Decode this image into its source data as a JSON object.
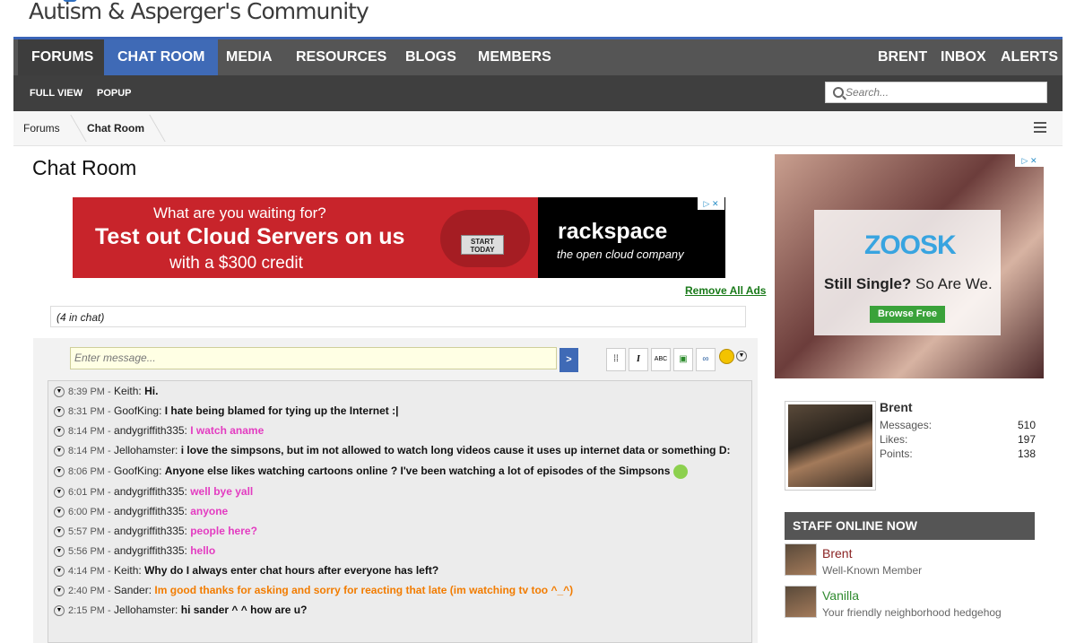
{
  "site": {
    "title": "Autism & Asperger's Community"
  },
  "nav": {
    "items": [
      {
        "label": "FORUMS"
      },
      {
        "label": "CHAT ROOM"
      },
      {
        "label": "MEDIA"
      },
      {
        "label": "RESOURCES"
      },
      {
        "label": "BLOGS"
      },
      {
        "label": "MEMBERS"
      }
    ],
    "user_items": [
      {
        "label": "BRENT"
      },
      {
        "label": "INBOX"
      },
      {
        "label": "ALERTS"
      }
    ]
  },
  "subnav": {
    "items": [
      {
        "label": "FULL VIEW"
      },
      {
        "label": "POPUP"
      }
    ],
    "search_placeholder": "Search..."
  },
  "breadcrumb": {
    "items": [
      {
        "label": "Forums"
      },
      {
        "label": "Chat Room"
      }
    ]
  },
  "page": {
    "title": "Chat Room"
  },
  "ad_banner": {
    "line1": "What are you waiting for?",
    "line2": "Test out Cloud Servers on us",
    "line3": "with a $300 credit",
    "button": "START TODAY",
    "brand": "rackspace",
    "tagline": "the open cloud company",
    "choice": "▷ ✕"
  },
  "remove_ads": "Remove All Ads",
  "chat": {
    "count": "(4 in chat)",
    "input_placeholder": "Enter message...",
    "send": ">",
    "tools": [
      "⁞⁞",
      "I",
      "ABC",
      "▣",
      "∞"
    ],
    "messages": [
      {
        "time": "8:39 PM -",
        "user": "Keith:",
        "text": "Hi.",
        "color": "#111111"
      },
      {
        "time": "8:31 PM -",
        "user": "GoofKing:",
        "text": "I hate being blamed for tying up the Internet :|",
        "color": "#111111"
      },
      {
        "time": "8:14 PM -",
        "user": "andygriffith335:",
        "text": "I watch aname",
        "color": "#e33cc1"
      },
      {
        "time": "8:14 PM -",
        "user": "Jellohamster:",
        "text": "i love the simpsons, but im not allowed to watch long videos cause it uses up internet data or something D:",
        "color": "#111111"
      },
      {
        "time": "8:06 PM -",
        "user": "GoofKing:",
        "text": "Anyone else likes watching cartoons online ? I've been watching a lot of episodes of the Simpsons",
        "color": "#111111"
      },
      {
        "time": "6:01 PM -",
        "user": "andygriffith335:",
        "text": "well bye yall",
        "color": "#e33cc1"
      },
      {
        "time": "6:00 PM -",
        "user": "andygriffith335:",
        "text": "anyone",
        "color": "#e33cc1"
      },
      {
        "time": "5:57 PM -",
        "user": "andygriffith335:",
        "text": "people here?",
        "color": "#e33cc1"
      },
      {
        "time": "5:56 PM -",
        "user": "andygriffith335:",
        "text": "hello",
        "color": "#e33cc1"
      },
      {
        "time": "4:14 PM -",
        "user": "Keith:",
        "text": "Why do I always enter chat hours after everyone has left?",
        "color": "#111111"
      },
      {
        "time": "2:40 PM -",
        "user": "Sander:",
        "text": "Im good thanks for asking and sorry for reacting that late (im watching tv too ^_^)",
        "color": "#f27c00"
      },
      {
        "time": "2:15 PM -",
        "user": "Jellohamster:",
        "text": "hi sander ^ ^ how are u?",
        "color": "#111111"
      }
    ]
  },
  "side_ad": {
    "brand": "ZOOSK",
    "headline_bold": "Still Single?",
    "headline_rest": "So Are We.",
    "button": "Browse Free",
    "choice": "▷ ✕"
  },
  "user_panel": {
    "name": "Brent",
    "stats": [
      {
        "label": "Messages:",
        "value": "510"
      },
      {
        "label": "Likes:",
        "value": "197"
      },
      {
        "label": "Points:",
        "value": "138"
      }
    ]
  },
  "staff": {
    "heading": "STAFF ONLINE NOW",
    "members": [
      {
        "name": "Brent",
        "role": "Well-Known Member",
        "color": "#8a2323"
      },
      {
        "name": "Vanilla",
        "role": "Your friendly neighborhood hedgehog",
        "color": "#2f8a2f"
      }
    ]
  }
}
